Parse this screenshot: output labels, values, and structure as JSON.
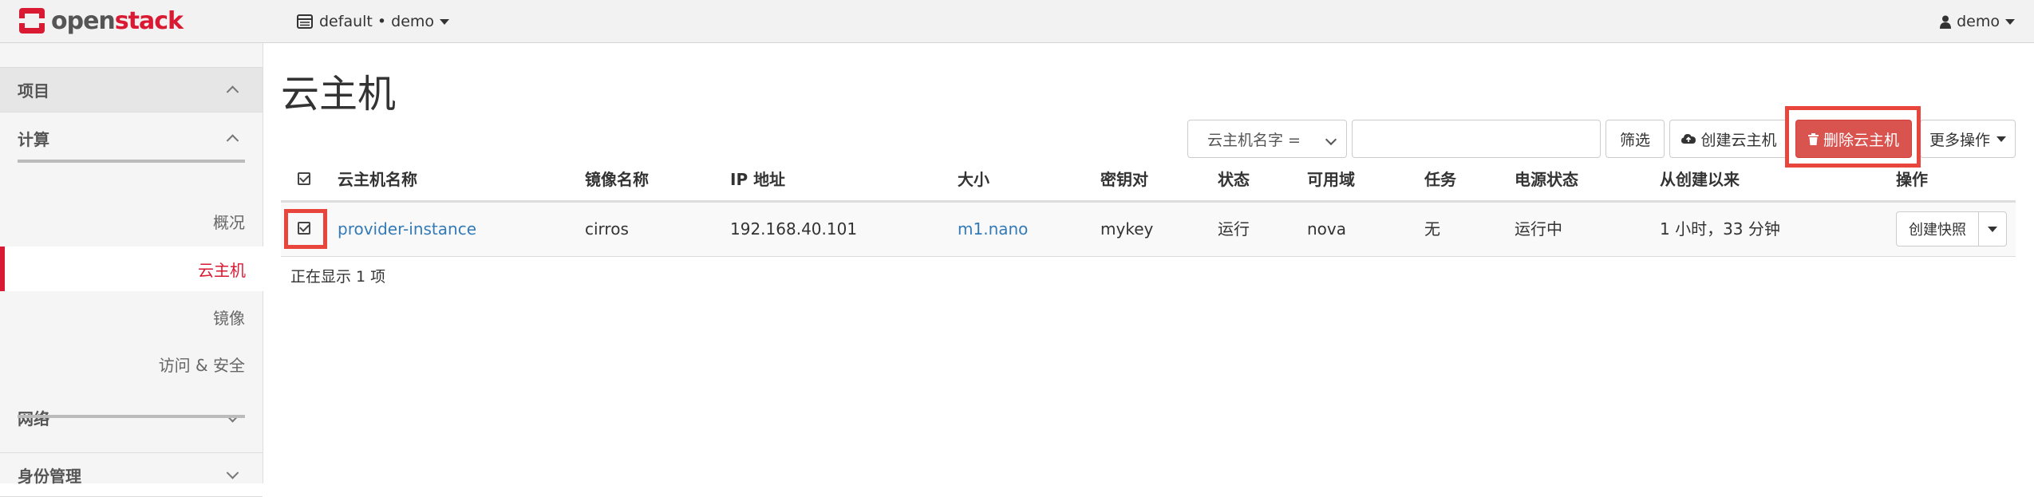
{
  "header": {
    "logo": {
      "part1": "open",
      "part2": "stack"
    },
    "project_switcher": "default • demo",
    "user": "demo"
  },
  "sidebar": {
    "sections": {
      "project": "项目",
      "compute": "计算",
      "network": "网络",
      "identity": "身份管理"
    },
    "compute_items": [
      {
        "label": "概况",
        "active": false
      },
      {
        "label": "云主机",
        "active": true
      },
      {
        "label": "镜像",
        "active": false
      },
      {
        "label": "访问 & 安全",
        "active": false
      }
    ]
  },
  "page": {
    "title": "云主机"
  },
  "toolbar": {
    "filter_select": "云主机名字 =",
    "filter_input_value": "",
    "filter_button": "筛选",
    "create_button": "创建云主机",
    "delete_button": "删除云主机",
    "more_button": "更多操作"
  },
  "table": {
    "columns": [
      "云主机名称",
      "镜像名称",
      "IP 地址",
      "大小",
      "密钥对",
      "状态",
      "可用域",
      "任务",
      "电源状态",
      "从创建以来",
      "操作"
    ],
    "rows": [
      {
        "checked": true,
        "name": "provider-instance",
        "image": "cirros",
        "ip": "192.168.40.101",
        "size": "m1.nano",
        "keypair": "mykey",
        "status": "运行",
        "zone": "nova",
        "task": "无",
        "power": "运行中",
        "age": "1 小时，33 分钟",
        "action": "创建快照"
      }
    ],
    "footer": "正在显示 1 项"
  },
  "colors": {
    "accent": "#da1a32",
    "danger": "#d9534f",
    "link": "#337ab7",
    "highlight_box": "#e8453c"
  }
}
